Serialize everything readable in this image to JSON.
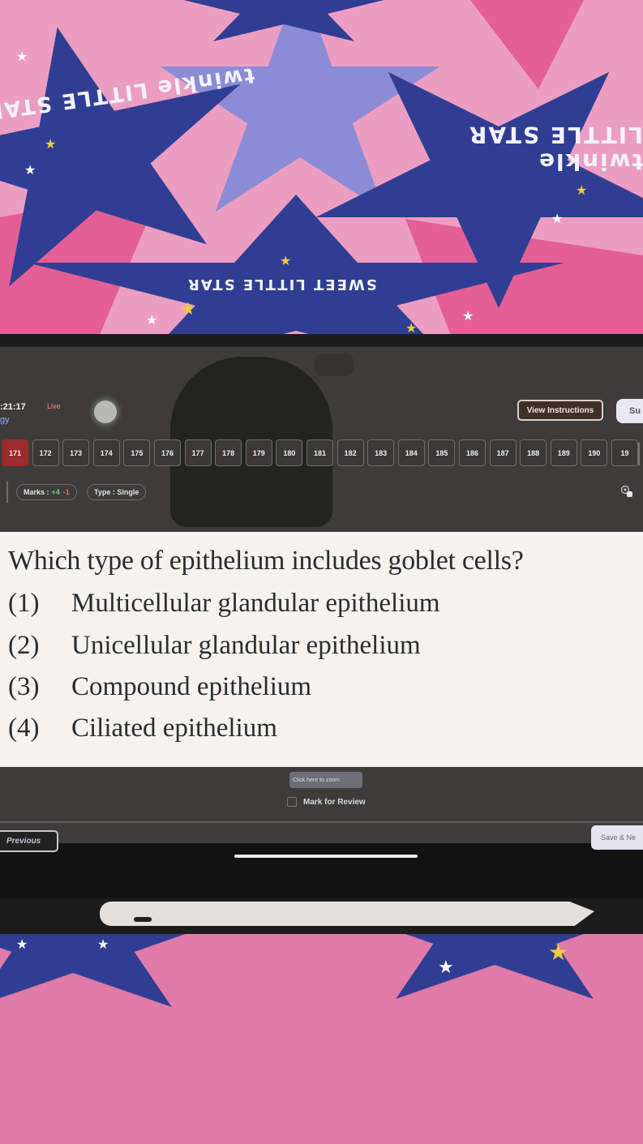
{
  "background": {
    "fabric_texts": [
      "twinkle LITTLE STAR",
      "twinkle LITTLE STAR",
      "SWEET LITTLE STAR"
    ]
  },
  "header": {
    "timer": ":21:17",
    "subject_fragment": "gy",
    "live_label": "Live",
    "view_instructions_label": "View Instructions",
    "submit_label_fragment": "Su"
  },
  "palette": {
    "active": "171",
    "questions": [
      "171",
      "172",
      "173",
      "174",
      "175",
      "176",
      "177",
      "178",
      "179",
      "180",
      "181",
      "182",
      "183",
      "184",
      "185",
      "186",
      "187",
      "188",
      "189",
      "190",
      "19"
    ]
  },
  "meta": {
    "marks_label": "Marks :",
    "marks_positive": "+4",
    "marks_negative": "-1",
    "type_label": "Type : Single",
    "report_icon": "report-icon"
  },
  "question": {
    "text": "Which type of epithelium includes goblet cells?",
    "options": [
      {
        "num": "(1)",
        "text": "Multicellular glandular epithelium"
      },
      {
        "num": "(2)",
        "text": "Unicellular glandular epithelium"
      },
      {
        "num": "(3)",
        "text": "Compound epithelium"
      },
      {
        "num": "(4)",
        "text": "Ciliated epithelium"
      }
    ]
  },
  "footer": {
    "zoom_hint": "Click here to zoom",
    "mark_review_label": "Mark for Review",
    "previous_label": "Previous",
    "save_next_label": "Save & Ne"
  },
  "colors": {
    "active_question": "#9c2b2b",
    "marks_positive": "#6ed17a",
    "marks_negative": "#ff6b6b",
    "live": "#ff8c82"
  }
}
